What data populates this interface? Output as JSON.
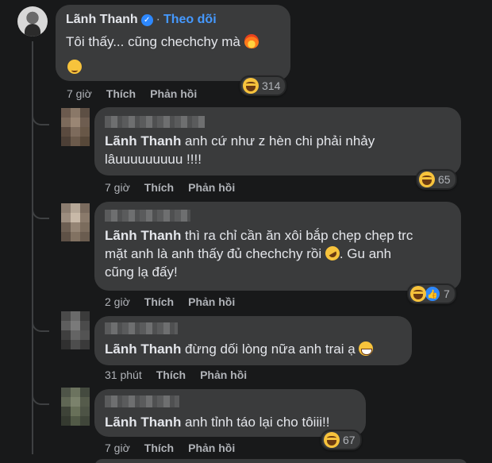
{
  "main_comment": {
    "author": "Lãnh Thanh",
    "follow_label": "Theo dõi",
    "separator": "·",
    "text": "Tôi thấy... cũng chechchy mà",
    "time": "7 giờ",
    "like_label": "Thích",
    "reply_label": "Phản hồi",
    "reaction_count": "314",
    "emojis": [
      "fire-emoji",
      "relieved-face-emoji"
    ]
  },
  "replies": [
    {
      "mention": "Lãnh Thanh",
      "text_line1": " anh cứ như z hèn chi phải nhảy",
      "text_line2": "lâuuuuuuuuu !!!!",
      "time": "7 giờ",
      "like_label": "Thích",
      "reply_label": "Phản hồi",
      "reaction_count": "65"
    },
    {
      "mention": "Lãnh Thanh",
      "text_line1": " thì ra chỉ cần ăn xôi bắp chẹp chẹp trc",
      "text_line2": "mặt anh là anh thấy đủ chechchy rồi",
      "text_line2_tail": ". Gu anh",
      "text_line3": "cũng lạ đấy!",
      "time": "2 giờ",
      "like_label": "Thích",
      "reply_label": "Phản hồi",
      "reaction_count": "7"
    },
    {
      "mention": "Lãnh Thanh",
      "text_line1": " đừng dối lòng nữa anh trai ạ",
      "time": "31 phút",
      "like_label": "Thích",
      "reply_label": "Phản hồi"
    },
    {
      "mention": "Lãnh Thanh",
      "text_line1": " anh tỉnh táo lại cho tôiii!!",
      "time": "7 giờ",
      "like_label": "Thích",
      "reply_label": "Phản hồi",
      "reaction_count": "67"
    }
  ],
  "colors": {
    "background": "#18191a",
    "bubble": "#3a3b3c",
    "link_blue": "#4599ff",
    "secondary_text": "#b0b3b8"
  }
}
